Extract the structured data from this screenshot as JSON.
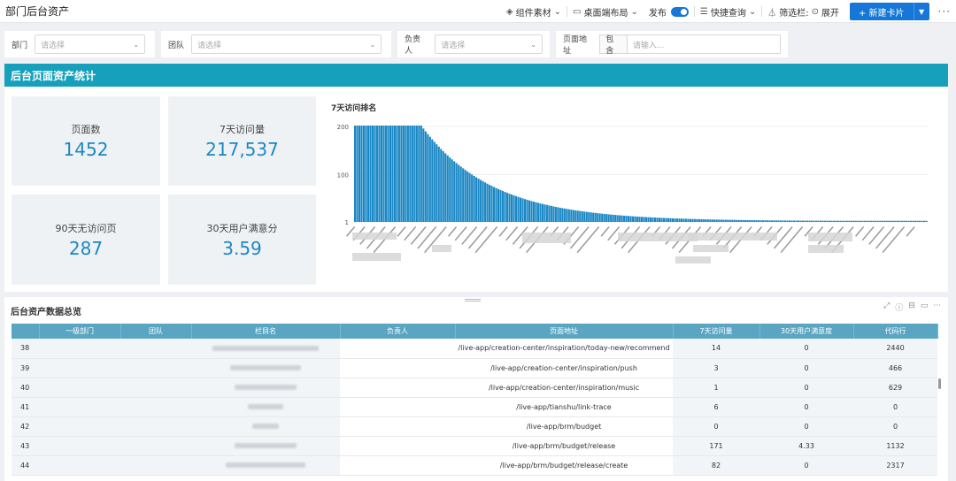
{
  "header": {
    "title": "部门后台资产",
    "actions": {
      "components": "组件素材",
      "layout": "桌面端布局",
      "publish": "发布",
      "quick_query": "快捷查询",
      "filter_bar": "筛选栏:",
      "expand": "展开",
      "new_card": "+ 新建卡片"
    }
  },
  "filters": {
    "department": {
      "label": "部门",
      "placeholder": "请选择"
    },
    "team": {
      "label": "团队",
      "placeholder": "请选择"
    },
    "owner": {
      "label": "负责人",
      "placeholder": "请选择"
    },
    "page_url": {
      "label": "页面地址",
      "operator": "包含",
      "placeholder": "请输入..."
    }
  },
  "banner": {
    "title": "后台页面资产统计"
  },
  "stats": [
    {
      "label": "页面数",
      "value": "1452"
    },
    {
      "label": "7天访问量",
      "value": "217,537"
    },
    {
      "label": "90天无访问页",
      "value": "287"
    },
    {
      "label": "30天用户满意分",
      "value": "3.59"
    }
  ],
  "chart_data": {
    "type": "bar",
    "title": "7天访问排名",
    "yticks": [
      "200",
      "100",
      "1"
    ],
    "ylim": [
      1,
      200
    ],
    "bar_count": 260,
    "color": "#1a87c4",
    "description_curve": "values plateau at 200 for first ~30 bars, then decay exponentially toward 1"
  },
  "table": {
    "title": "后台资产数据总览",
    "columns": [
      "一级部门",
      "团队",
      "栏目名",
      "负责人",
      "页面地址",
      "7天访问量",
      "30天用户满意度",
      "代码行"
    ],
    "rows": [
      {
        "idx": "38",
        "url": "/live-app/creation-center/inspiration/today-new/recommend",
        "visits": "14",
        "sat": "0",
        "loc": "2440"
      },
      {
        "idx": "39",
        "url": "/live-app/creation-center/inspiration/push",
        "visits": "3",
        "sat": "0",
        "loc": "466"
      },
      {
        "idx": "40",
        "url": "/live-app/creation-center/inspiration/music",
        "visits": "1",
        "sat": "0",
        "loc": "629"
      },
      {
        "idx": "41",
        "url": "/live-app/tianshu/link-trace",
        "visits": "6",
        "sat": "0",
        "loc": "0"
      },
      {
        "idx": "42",
        "url": "/live-app/brm/budget",
        "visits": "0",
        "sat": "0",
        "loc": "0"
      },
      {
        "idx": "43",
        "url": "/live-app/brm/budget/release",
        "visits": "171",
        "sat": "4.33",
        "loc": "1132"
      },
      {
        "idx": "44",
        "url": "/live-app/brm/budget/release/create",
        "visits": "82",
        "sat": "0",
        "loc": "2317"
      }
    ]
  }
}
